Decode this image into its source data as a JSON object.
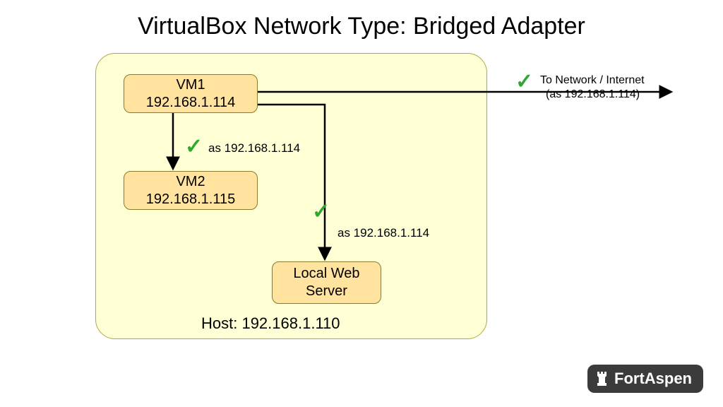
{
  "title": "VirtualBox Network Type: Bridged Adapter",
  "host": {
    "label": "Host: 192.168.1.110"
  },
  "nodes": {
    "vm1": {
      "name": "VM1",
      "ip": "192.168.1.114"
    },
    "vm2": {
      "name": "VM2",
      "ip": "192.168.1.115"
    },
    "web": {
      "line1": "Local Web",
      "line2": "Server"
    }
  },
  "edges": {
    "vm1_to_vm2": {
      "label": "as 192.168.1.114",
      "status": "ok"
    },
    "vm1_to_web": {
      "label": "as 192.168.1.114",
      "status": "ok"
    },
    "vm1_to_internet": {
      "line1": "To Network / Internet",
      "line2": "(as 192.168.1.114)",
      "status": "ok"
    }
  },
  "brand": {
    "name": "FortAspen"
  },
  "colors": {
    "host_bg": "#feffd5",
    "node_bg": "#ffe39f",
    "check": "#2ea82e",
    "logo_bg": "#3b3b3b"
  }
}
